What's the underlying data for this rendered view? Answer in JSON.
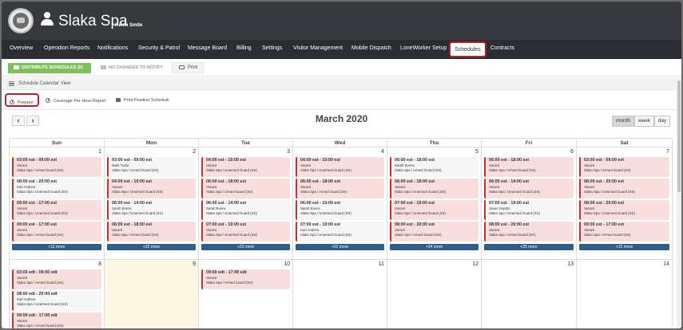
{
  "header": {
    "site_name": "Slaka Spa",
    "user_name": "Helen Smite"
  },
  "nav": {
    "items": [
      {
        "label": "Overview"
      },
      {
        "label": "Operation Reports"
      },
      {
        "label": "Notifications"
      },
      {
        "label": "Security & Patrol"
      },
      {
        "label": "Message Board"
      },
      {
        "label": "Billing"
      },
      {
        "label": "Settings"
      },
      {
        "label": "Visitor Management"
      },
      {
        "label": "Mobile Dispatch"
      },
      {
        "label": "LoneWorker Setup"
      },
      {
        "label": "Schedules",
        "active": true
      },
      {
        "label": "Contracts"
      }
    ]
  },
  "toolbar": {
    "distribute_label": "DISTRIBUTE SCHEDULES (5)",
    "no_changes_label": "NO CHANGES TO NOTIFY",
    "print_label": "Print"
  },
  "view_title": "Schedule Calendar View",
  "actions": {
    "prepare_label": "Prepare",
    "coverage_label": "Coverage Per Hour Report",
    "print_position_label": "Print Position Schedule"
  },
  "calendar": {
    "title": "March 2020",
    "prev_glyph": "‹",
    "next_glyph": "›",
    "views": [
      {
        "label": "month",
        "active": true
      },
      {
        "label": "week"
      },
      {
        "label": "day"
      }
    ],
    "weekdays": [
      "Sun",
      "Mon",
      "Tue",
      "Wed",
      "Thu",
      "Fri",
      "Sat"
    ],
    "weeks": [
      {
        "days": [
          {
            "num": "1",
            "more": "+11 more",
            "events": [
              {
                "time": "03:00 est - 09:00 est",
                "who": "Vacant",
                "post": "Slaka Spa / Armed Guard (SS)",
                "vacant": true
              },
              {
                "time": "08:00 est - 20:00 est",
                "who": "Karl Andrew",
                "post": "Slaka Spa / Unarmed Guard (SS)",
                "vacant": false
              },
              {
                "time": "09:00 est - 17:00 est",
                "who": "Vacant",
                "post": "Slaka Spa / Unarmed Guard (SS)",
                "vacant": true
              },
              {
                "time": "09:00 est - 17:00 est",
                "who": "Vacant",
                "post": "Slaka Spa / Armed Guard (SS)",
                "vacant": true
              }
            ]
          },
          {
            "num": "2",
            "more": "+22 more",
            "events": [
              {
                "time": "03:00 est - 09:00 est",
                "who": "Mark Tudor",
                "post": "Slaka Spa / Armed Guard (SS)",
                "vacant": false
              },
              {
                "time": "04:00 est - 10:00 est",
                "who": "Vacant",
                "post": "Slaka Spa / Unarmed Guard (SS)",
                "vacant": true
              },
              {
                "time": "06:00 est - 14:00 est",
                "who": "Sarah Evens",
                "post": "Slaka Spa / Unarmed Guard (SS)",
                "vacant": false
              },
              {
                "time": "06:00 est - 18:00 est",
                "who": "Vacant",
                "post": "Slaka Spa / Armed Guard (SS)",
                "vacant": true
              }
            ]
          },
          {
            "num": "3",
            "more": "+23 more",
            "events": [
              {
                "time": "04:00 est - 10:00 est",
                "who": "Vacant",
                "post": "Slaka Spa / Unarmed Guard (SS)",
                "vacant": true
              },
              {
                "time": "06:00 est - 18:00 est",
                "who": "Vacant",
                "post": "Slaka Spa / Armed Guard (SS)",
                "vacant": true
              },
              {
                "time": "06:00 est - 14:00 est",
                "who": "Sarah Evens",
                "post": "Slaka Spa / Unarmed Guard (SS)",
                "vacant": false
              },
              {
                "time": "07:00 est - 19:00 est",
                "who": "Vacant",
                "post": "Slaka Spa / Unarmed Guard (SS)",
                "vacant": true
              }
            ]
          },
          {
            "num": "4",
            "more": "+22 more",
            "events": [
              {
                "time": "04:00 est - 10:00 est",
                "who": "Vacant",
                "post": "Slaka Spa / Unarmed Guard (SS)",
                "vacant": true
              },
              {
                "time": "06:00 est - 18:00 est",
                "who": "Vacant",
                "post": "Slaka Spa / Armed Guard (SS)",
                "vacant": true
              },
              {
                "time": "06:00 est - 15:00 est",
                "who": "Sarah Evens",
                "post": "Slaka Spa / Unarmed Guard (SS)",
                "vacant": false
              },
              {
                "time": "07:00 est - 19:00 est",
                "who": "Karl Andrew",
                "post": "Slaka Spa / Unarmed Guard (SS)",
                "vacant": false
              }
            ]
          },
          {
            "num": "5",
            "more": "+24 more",
            "events": [
              {
                "time": "06:00 est - 18:00 est",
                "who": "Sarah Evens",
                "post": "Slaka Spa / Armed Guard (SS)",
                "vacant": false
              },
              {
                "time": "06:00 est - 18:00 est",
                "who": "Vacant",
                "post": "Slaka Spa / Unarmed Guard (SS)",
                "vacant": true
              },
              {
                "time": "07:00 est - 19:00 est",
                "who": "Vacant",
                "post": "Slaka Spa / Unarmed Guard (SS)",
                "vacant": true
              },
              {
                "time": "08:00 est - 20:00 est",
                "who": "Vacant",
                "post": "Slaka Spa / Armed Guard (SS)",
                "vacant": true
              }
            ]
          },
          {
            "num": "6",
            "more": "+25 more",
            "events": [
              {
                "time": "06:00 est - 18:00 est",
                "who": "Vacant",
                "post": "Slaka Spa / Armed Guard (SS)",
                "vacant": true
              },
              {
                "time": "06:00 est - 14:00 est",
                "who": "Vacant",
                "post": "Slaka Spa / Unarmed Guard (SS)",
                "vacant": true
              },
              {
                "time": "07:00 est - 19:00 est",
                "who": "Javier Gupton",
                "post": "Slaka Spa / Unarmed Guard (SS)",
                "vacant": false
              },
              {
                "time": "08:00 est - 20:00 est",
                "who": "Vacant",
                "post": "Slaka Spa / Armed Guard (SS)",
                "vacant": true
              }
            ]
          },
          {
            "num": "7",
            "more": "+12 more",
            "events": [
              {
                "time": "03:00 est - 09:00 est",
                "who": "Vacant",
                "post": "Slaka Spa / Armed Guard (SS)",
                "vacant": true
              },
              {
                "time": "08:00 est - 20:00 est",
                "who": "Vacant",
                "post": "Slaka Spa / Unarmed Guard (SS)",
                "vacant": true
              },
              {
                "time": "08:00 est - 20:00 est",
                "who": "Vacant",
                "post": "Slaka Spa / Unarmed Guard (SS)",
                "vacant": true
              },
              {
                "time": "09:00 est - 17:00 est",
                "who": "Vacant",
                "post": "Slaka Spa / Armed Guard (SS)",
                "vacant": true
              }
            ]
          }
        ]
      },
      {
        "days": [
          {
            "num": "8",
            "events": [
              {
                "time": "03:00 edt - 09:00 edt",
                "who": "Vacant",
                "post": "Slaka Spa / Armed Guard (SS)",
                "vacant": true
              },
              {
                "time": "08:00 edt - 20:00 edt",
                "who": "Karl Andrew",
                "post": "Slaka Spa / Unarmed Guard (SS)",
                "vacant": false
              },
              {
                "time": "09:00 edt - 17:00 edt",
                "who": "Vacant",
                "post": "Slaka Spa / Armed Guard (SS)",
                "vacant": true
              }
            ]
          },
          {
            "num": "9",
            "today": true,
            "events": []
          },
          {
            "num": "10",
            "events": [
              {
                "time": "09:00 edt - 17:00 edt",
                "who": "Vacant",
                "post": "Slaka Spa / Armed Guard (SS)",
                "vacant": true
              }
            ]
          },
          {
            "num": "11",
            "events": []
          },
          {
            "num": "12",
            "events": []
          },
          {
            "num": "13",
            "events": []
          },
          {
            "num": "14",
            "events": []
          }
        ]
      }
    ]
  }
}
